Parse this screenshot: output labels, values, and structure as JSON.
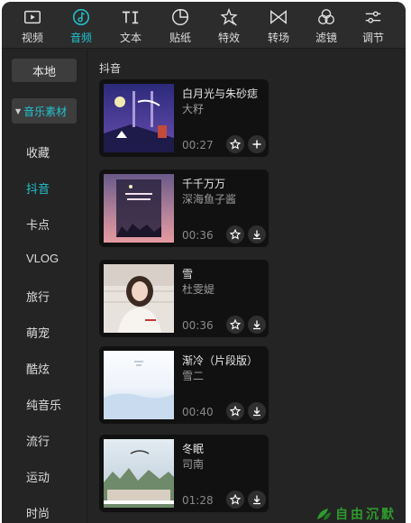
{
  "tabs": [
    {
      "label": "视频",
      "icon": "video-icon",
      "active": false
    },
    {
      "label": "音频",
      "icon": "audio-icon",
      "active": true
    },
    {
      "label": "文本",
      "icon": "text-icon",
      "active": false
    },
    {
      "label": "贴纸",
      "icon": "sticker-icon",
      "active": false
    },
    {
      "label": "特效",
      "icon": "effects-icon",
      "active": false
    },
    {
      "label": "转场",
      "icon": "transition-icon",
      "active": false
    },
    {
      "label": "滤镜",
      "icon": "filter-icon",
      "active": false
    },
    {
      "label": "调节",
      "icon": "adjust-icon",
      "active": false
    }
  ],
  "sidebar": {
    "local_label": "本地",
    "music_label": "音乐素材",
    "categories": [
      "收藏",
      "抖音",
      "卡点",
      "VLOG",
      "旅行",
      "萌宠",
      "酷炫",
      "纯音乐",
      "流行",
      "运动",
      "时尚"
    ],
    "active_category": "抖音"
  },
  "section_title": "抖音",
  "songs": [
    {
      "title": "白月光与朱砂痣",
      "artist": "大籽",
      "duration": "00:27",
      "action_icon": "plus-icon"
    },
    {
      "title": "千千万万",
      "artist": "深海鱼子酱",
      "duration": "00:36",
      "action_icon": "download-icon"
    },
    {
      "title": "雪",
      "artist": "杜雯媞",
      "duration": "00:36",
      "action_icon": "download-icon"
    },
    {
      "title": "渐冷（片段版）",
      "artist": "雪二",
      "duration": "00:40",
      "action_icon": "download-icon"
    },
    {
      "title": "冬眠",
      "artist": "司南",
      "duration": "01:28",
      "action_icon": "download-icon"
    }
  ],
  "colors": {
    "accent": "#22c3cf",
    "background": "#242424",
    "card": "#111111"
  },
  "watermark": {
    "text": "自由沉默"
  }
}
